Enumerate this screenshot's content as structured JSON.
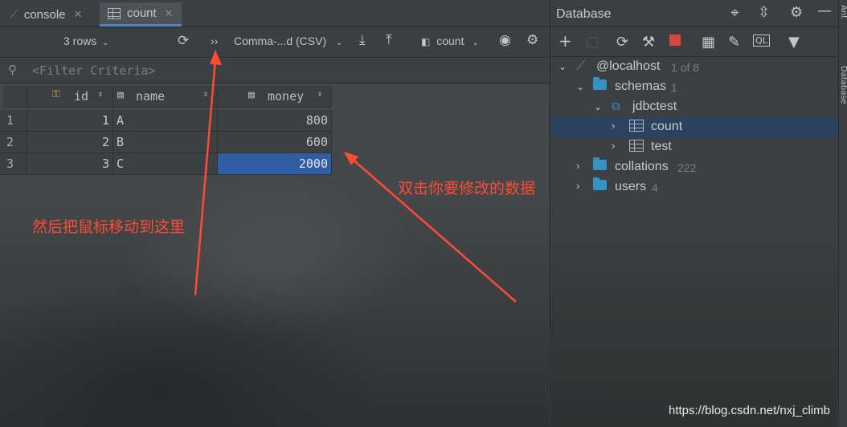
{
  "tabs": [
    {
      "label": "console",
      "active": false
    },
    {
      "label": "count",
      "active": true
    }
  ],
  "toolbar": {
    "rows_label": "3 rows",
    "more_label": "››",
    "format_label": "Comma-...d (CSV)",
    "table_label": "count"
  },
  "filter": {
    "placeholder": "<Filter Criteria>"
  },
  "grid": {
    "columns": [
      "id",
      "name",
      "money"
    ],
    "rows": [
      {
        "num": "1",
        "id": "1",
        "name": "A",
        "money": "800"
      },
      {
        "num": "2",
        "id": "2",
        "name": "B",
        "money": "600"
      },
      {
        "num": "3",
        "id": "3",
        "name": "C",
        "money": "2000"
      }
    ],
    "selected_cell": "money row 3"
  },
  "annotations": {
    "left": "然后把鼠标移动到这里",
    "right": "双击你要修改的数据"
  },
  "database_panel": {
    "title": "Database",
    "tree": {
      "host": {
        "label": "@localhost",
        "meta": "1 of 8"
      },
      "schemas": {
        "label": "schemas",
        "count": "1"
      },
      "schema": {
        "label": "jdbctest"
      },
      "tables": [
        {
          "label": "count",
          "selected": true
        },
        {
          "label": "test",
          "selected": false
        }
      ],
      "collations": {
        "label": "collations",
        "count": "222"
      },
      "users": {
        "label": "users",
        "count": "4"
      }
    }
  },
  "side_strip": {
    "top_label": "Ant",
    "db_label": "Database"
  },
  "watermark": "https://blog.csdn.net/nxj_climb",
  "colors": {
    "accent": "#4a88c7",
    "selection": "#2f5ea6",
    "annotation": "#ff4a35",
    "folder": "#3592c4"
  }
}
